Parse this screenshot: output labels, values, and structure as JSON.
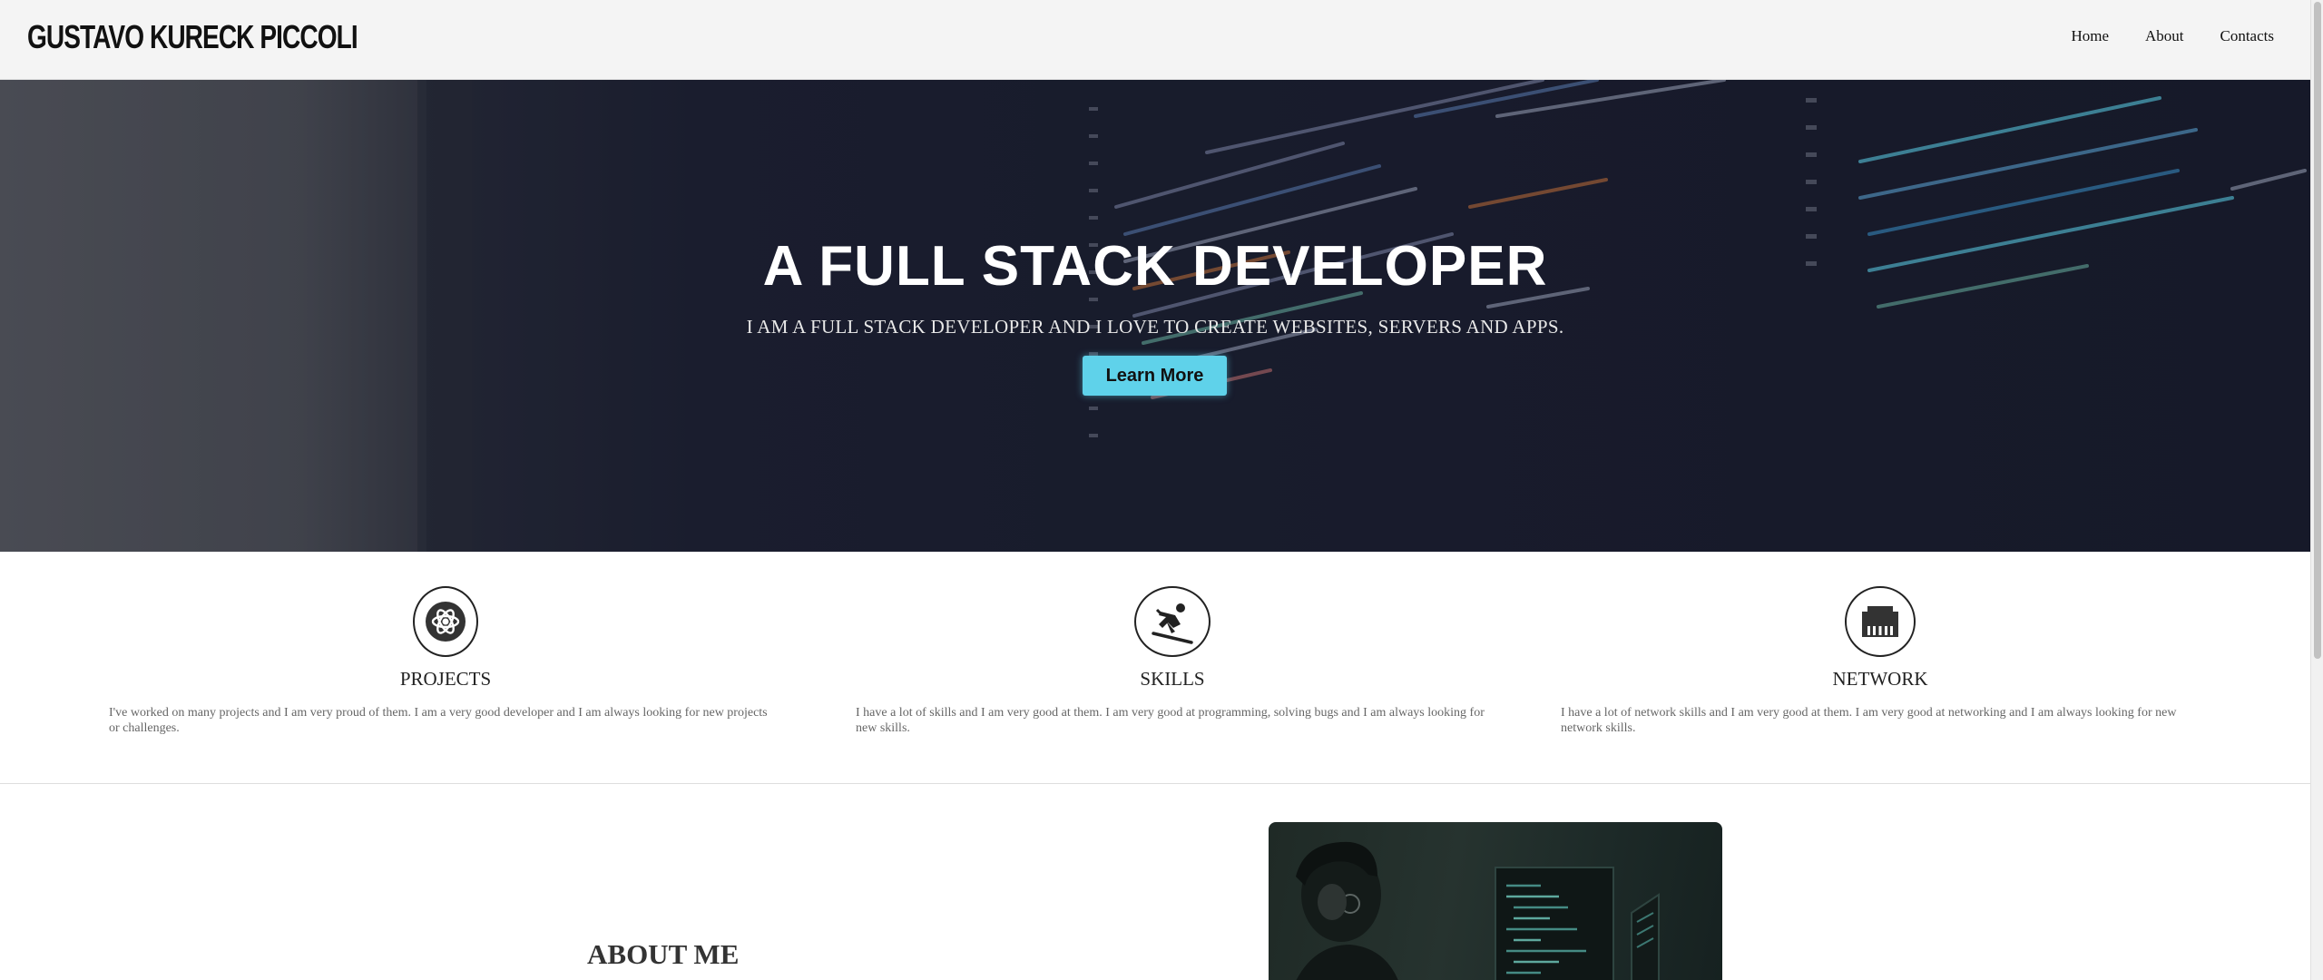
{
  "header": {
    "brand": "GUSTAVO KURECK PICCOLI",
    "nav": [
      "Home",
      "About",
      "Contacts"
    ]
  },
  "hero": {
    "title": "A FULL STACK DEVELOPER",
    "subtitle": "I AM A FULL STACK DEVELOPER AND I LOVE TO CREATE WEBSITES, SERVERS AND APPS.",
    "button_label": "Learn More",
    "button_color": "#5fd2ea"
  },
  "features": [
    {
      "icon": "atom-icon",
      "title": "PROJECTS",
      "text": "I've worked on many projects and I am very proud of them. I am a very good developer and I am always looking for new projects or challenges."
    },
    {
      "icon": "skiing-icon",
      "title": "SKILLS",
      "text": "I have a lot of skills and I am very good at them. I am very good at programming, solving bugs and I am always looking for new skills."
    },
    {
      "icon": "ethernet-icon",
      "title": "NETWORK",
      "text": "I have a lot of network skills and I am very good at them. I am very good at networking and I am always looking for new network skills."
    }
  ],
  "about": {
    "title": "ABOUT ME"
  }
}
